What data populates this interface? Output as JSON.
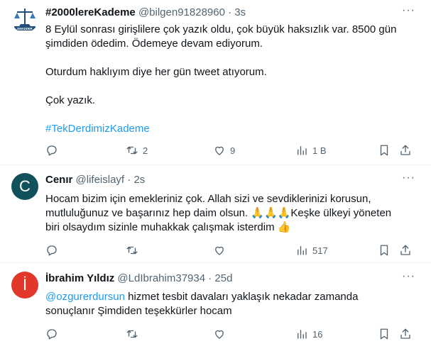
{
  "tweets": [
    {
      "name": "#2000lereKademe",
      "handle": "@bilgen91828960",
      "sep": "·",
      "time": "3s",
      "more": "···",
      "lines": [
        "8 Eylül sonrası girişlilere çok yazık oldu, çok büyük haksızlık var. 8500 gün",
        "şimdiden ödedim. Ödemeye devam ediyorum.",
        "Oturdum haklıyım diye her gün tweet atıyorum.",
        "Çok yazık."
      ],
      "hashtag": "#TekDerdimizKademe",
      "logo_text": "EMADDER",
      "stats": {
        "reply": "",
        "retweet": "2",
        "like": "9",
        "views": "1 B"
      }
    },
    {
      "name": "Cenır",
      "handle": "@lifeislayf",
      "sep": "·",
      "time": "2s",
      "more": "···",
      "avatar_letter": "C",
      "lines": [
        "Hocam bizim için emekleriniz çok. Allah sizi ve sevdiklerinizi korusun,",
        "mutluluğunuz ve başarınız hep daim olsun. ",
        "Keşke ülkeyi yöneten",
        "biri olsaydım sizinle muhakkak çalışmak isterdim "
      ],
      "emoji_pray": "🙏🙏🙏",
      "emoji_thumb": "👍",
      "stats": {
        "reply": "",
        "retweet": "",
        "like": "",
        "views": "517"
      }
    },
    {
      "name": "İbrahim Yıldız",
      "handle": "@LdIbrahim37934",
      "sep": "·",
      "time": "25d",
      "more": "···",
      "avatar_letter": "İ",
      "mention": "@ozgurerdursun",
      "lines": [
        " hizmet tesbit davaları yaklaşık nekadar zamanda",
        "sonuçlanır Şimdiden teşekkürler hocam"
      ],
      "stats": {
        "reply": "",
        "retweet": "",
        "like": "",
        "views": "16"
      }
    }
  ],
  "colors": {
    "link": "#1d9bf0",
    "muted": "#536471",
    "text": "#0f1419",
    "avatar_c": "#10515b",
    "avatar_i": "#e2382c"
  },
  "icons": [
    "reply-icon",
    "retweet-icon",
    "like-icon",
    "views-icon",
    "bookmark-icon",
    "share-icon"
  ]
}
